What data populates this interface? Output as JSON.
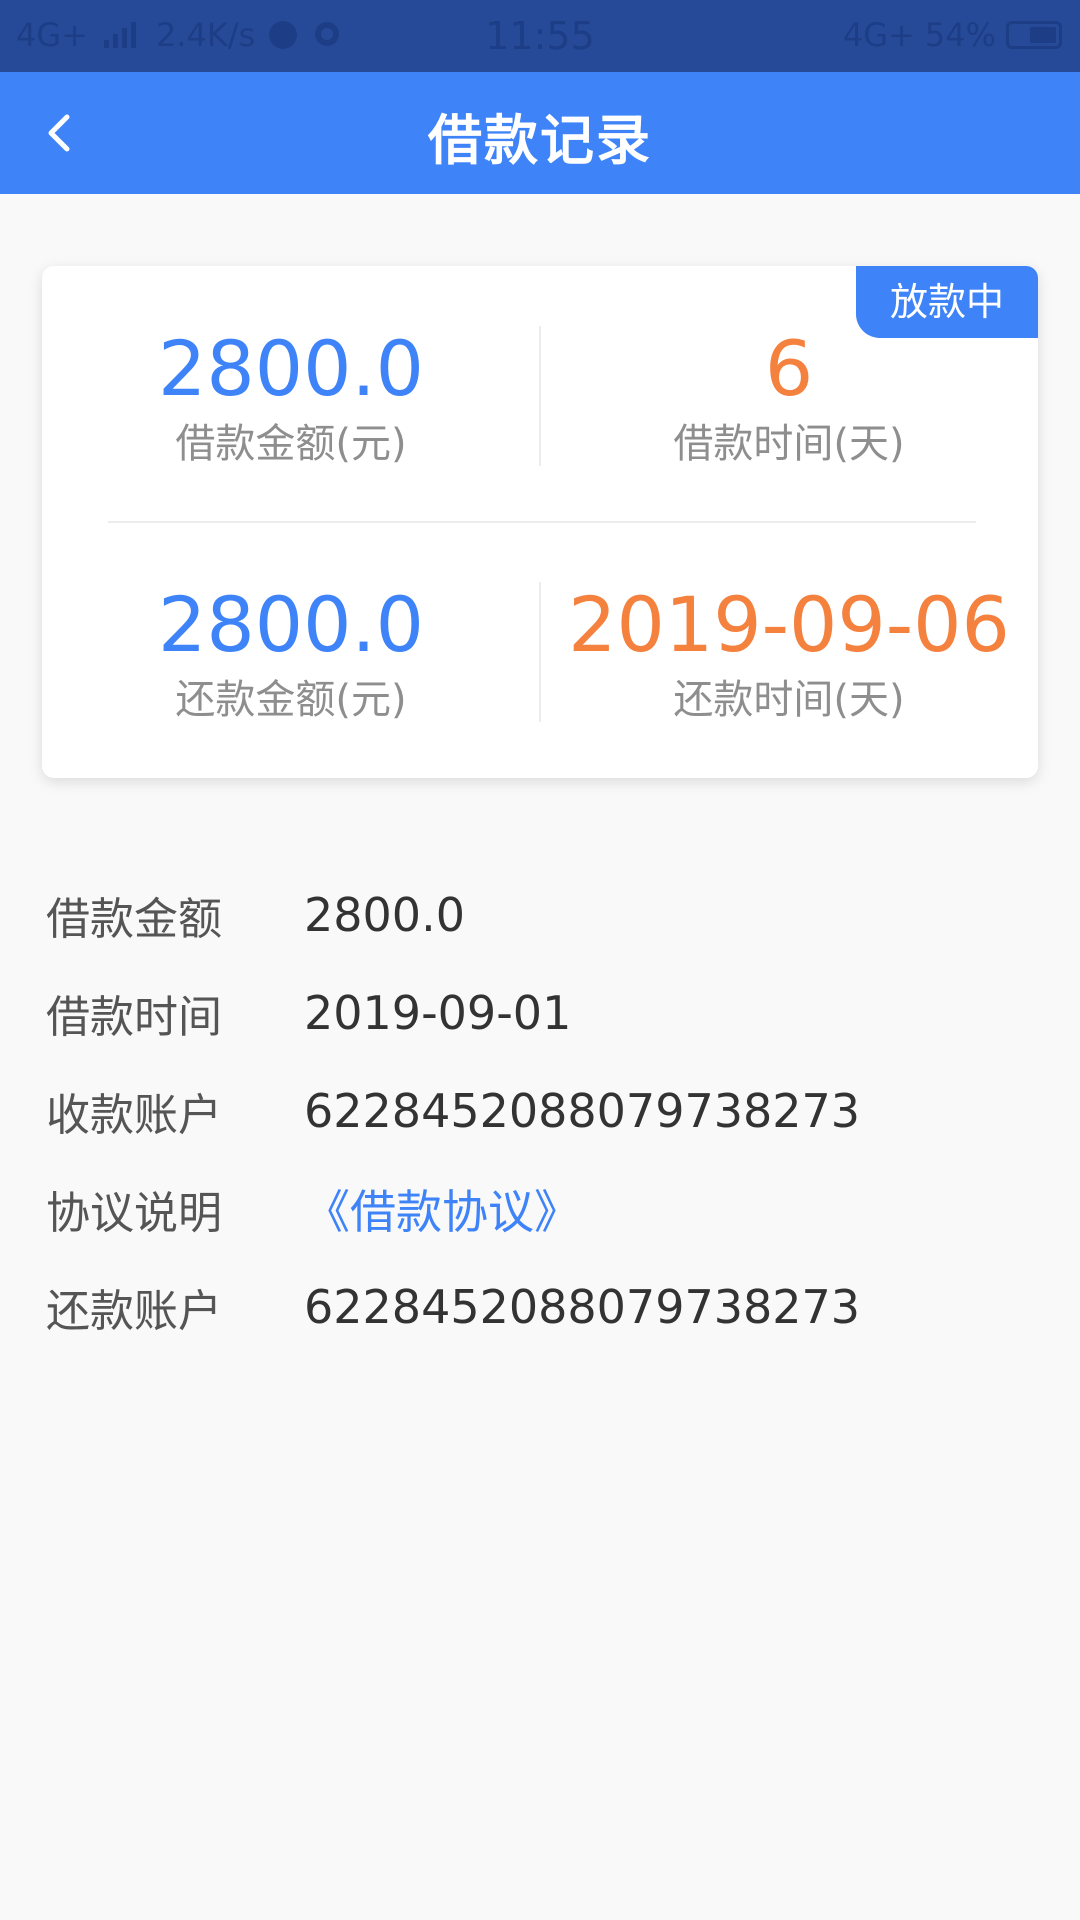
{
  "status_bar": {
    "network_left": "4G+",
    "speed": "2.4K/s",
    "time": "11:55",
    "network_right": "4G+",
    "battery": "54%"
  },
  "header": {
    "title": "借款记录",
    "back_icon": "chevron-left-icon"
  },
  "card": {
    "badge": "放款中",
    "loan_amount": {
      "value": "2800.0",
      "label": "借款金额(元)"
    },
    "loan_days": {
      "value": "6",
      "label": "借款时间(天)"
    },
    "repay_amount": {
      "value": "2800.0",
      "label": "还款金额(元)"
    },
    "repay_date": {
      "value": "2019-09-06",
      "label": "还款时间(天)"
    }
  },
  "details": {
    "loan_amount": {
      "label": "借款金额",
      "value": "2800.0"
    },
    "loan_date": {
      "label": "借款时间",
      "value": "2019-09-01"
    },
    "receive_account": {
      "label": "收款账户",
      "value": "6228452088079738273"
    },
    "agreement": {
      "label": "协议说明",
      "value": "《借款协议》"
    },
    "repay_account": {
      "label": "还款账户",
      "value": "6228452088079738273"
    }
  },
  "colors": {
    "header": "#3e83f8",
    "status_bar": "#274a98",
    "primary_blue": "#3e83f8",
    "accent_orange": "#f5813f",
    "background": "#f9f9f9"
  }
}
